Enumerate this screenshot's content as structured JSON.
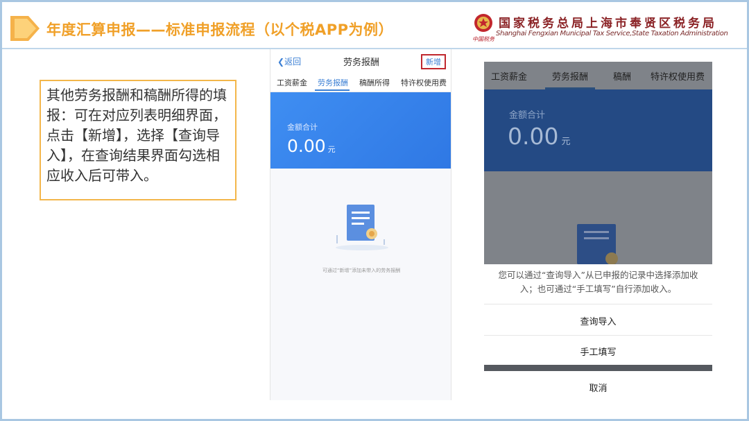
{
  "header": {
    "title": "年度汇算申报——标准申报流程（以个税APP为例）",
    "org_cn": "国家税务总局上海市奉贤区税务局",
    "org_en": "Shanghai Fengxian Municipal Tax Service,State Taxation Administration",
    "emblem_signature": "中国税务"
  },
  "note": {
    "text": "其他劳务报酬和稿酬所得的填报：可在对应列表明细界面，点击【新增】，选择【查询导入】，在查询结果界面勾选相应收入后可带入。"
  },
  "phone1": {
    "back_label": "返回",
    "title": "劳务报酬",
    "add_label": "新增",
    "tabs": [
      "工资薪金",
      "劳务报酬",
      "稿酬所得",
      "特许权使用费"
    ],
    "active_tab": "劳务报酬",
    "total_label": "金额合计",
    "total_amount": "0.00",
    "unit": "元",
    "empty_text": "可通过“新增”添加未带入的劳务报酬"
  },
  "phone2": {
    "tabs": [
      "工资薪金",
      "劳务报酬",
      "稿酬",
      "特许权使用费"
    ],
    "active_tab": "劳务报酬",
    "total_label": "金额合计",
    "total_amount": "0.00",
    "unit": "元",
    "sheet_message": "您可以通过“查询导入”从已申报的记录中选择添加收入；也可通过“手工填写”自行添加收入。",
    "option_query_import": "查询导入",
    "option_manual": "手工填写",
    "cancel_label": "取消"
  },
  "colors": {
    "title_orange": "#f0a028",
    "note_border": "#f3b64a",
    "app_blue": "#3b7fd4",
    "org_red": "#8b2326",
    "highlight_red": "#c0272d"
  }
}
